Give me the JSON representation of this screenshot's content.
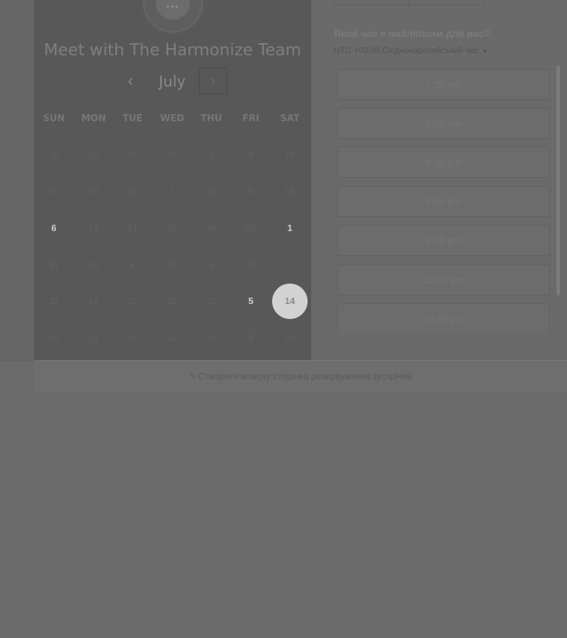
{
  "header": {
    "logo_glyph": "•••",
    "title": "Meet with The Harmonize Team"
  },
  "calendar": {
    "month": "July",
    "prev_glyph": "‹",
    "next_glyph": "›",
    "weekdays": [
      "SUN",
      "MON",
      "TUE",
      "WED",
      "THU",
      "FRI",
      "SAT"
    ],
    "weeks": [
      [
        "15",
        "15",
        "26",
        "16",
        "1",
        "8",
        "14"
      ],
      [
        "15",
        "19",
        "26",
        "7",
        "12",
        "8",
        "16"
      ],
      [
        "6",
        "15",
        "14",
        "26",
        "29",
        "20",
        "1"
      ],
      [
        "31",
        "29",
        "4",
        "31",
        "8",
        "30",
        "7"
      ],
      [
        "11",
        "19",
        "12",
        "31",
        "22",
        "5",
        "14"
      ],
      [
        "20",
        "23",
        "21",
        "24",
        "19",
        "9",
        "25"
      ]
    ],
    "available_days": [
      "6",
      "1",
      "5"
    ],
    "selected_day": "14"
  },
  "times": {
    "question": "Який час є найліпшим для вас?",
    "timezone": "UTC +03:00 Східноєвропейський час",
    "timezone_caret": "▼",
    "slots": [
      "7:30 pm",
      "8:00 pm",
      "8:30 pm",
      "9:00 pm",
      "9:30 pm",
      "10:00 pm",
      "10:30 pm"
    ]
  },
  "footer": {
    "icon_glyph": "✎",
    "link_text": "Створити власну сторінка резервування зустрічей"
  }
}
